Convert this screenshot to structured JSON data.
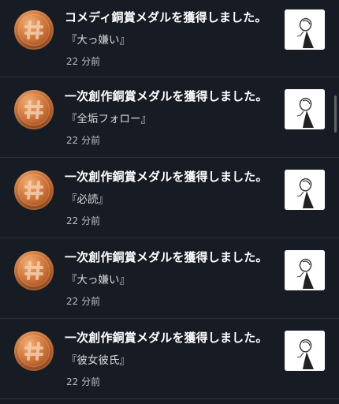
{
  "notifications": [
    {
      "title": "コメディ銅賞メダルを獲得しました。",
      "work": "『大っ嫌い』",
      "time": "22 分前",
      "icon": "bronze-medal-hash-icon"
    },
    {
      "title": "一次創作銅賞メダルを獲得しました。",
      "work": "『全垢フォロー』",
      "time": "22 分前",
      "icon": "bronze-medal-hash-icon"
    },
    {
      "title": "一次創作銅賞メダルを獲得しました。",
      "work": "『必読』",
      "time": "22 分前",
      "icon": "bronze-medal-hash-icon"
    },
    {
      "title": "一次創作銅賞メダルを獲得しました。",
      "work": "『大っ嫌い』",
      "time": "22 分前",
      "icon": "bronze-medal-hash-icon"
    },
    {
      "title": "一次創作銅賞メダルを獲得しました。",
      "work": "『彼女彼氏』",
      "time": "22 分前",
      "icon": "bronze-medal-hash-icon"
    }
  ],
  "colors": {
    "background": "#171b24",
    "divider": "#2b303b",
    "medal_bronze": "#b9612c",
    "text_primary": "#ffffff",
    "text_secondary": "#bdbdbd"
  }
}
